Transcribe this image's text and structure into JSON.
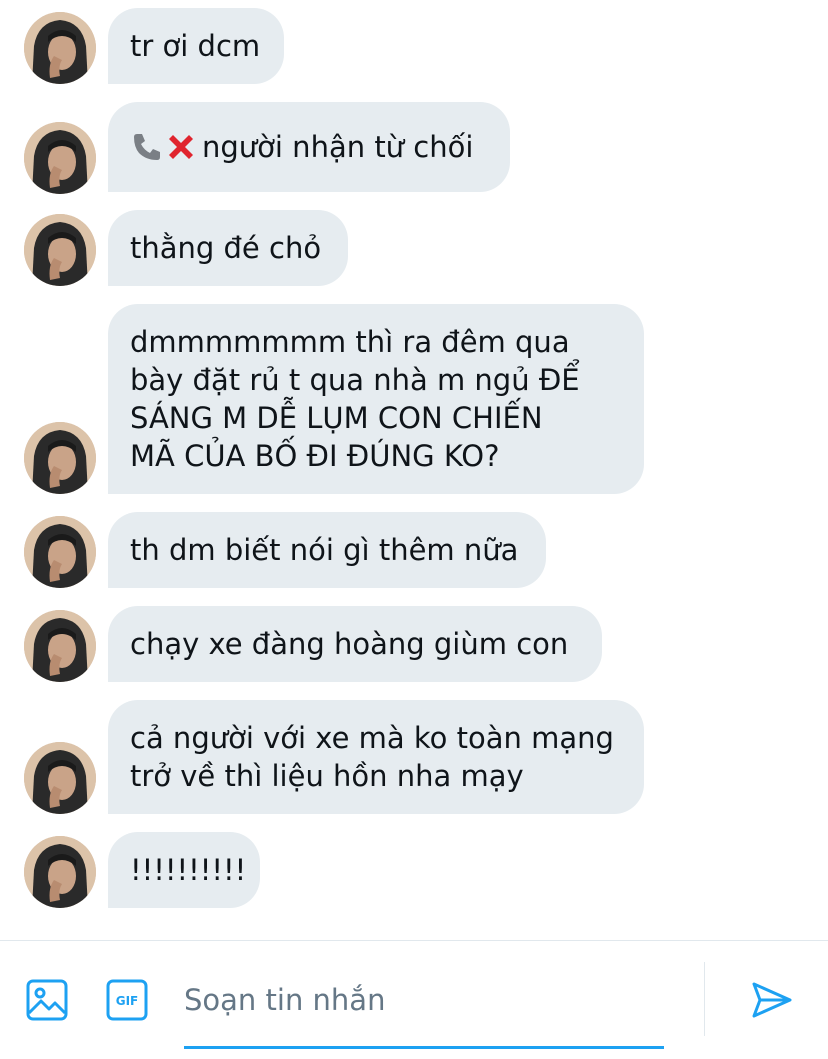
{
  "messages": [
    {
      "text": "tr ơi dcm"
    },
    {
      "text": "người nhận từ chối",
      "call_icons": [
        "phone-icon",
        "red-cross-icon"
      ]
    },
    {
      "text": "thằng đé chỏ"
    },
    {
      "text": "dmmmmmmm thì ra đêm qua\nbày đặt rủ t qua nhà m ngủ ĐỂ\nSÁNG M DỄ LỤM CON CHIẾN\nMÃ CỦA BỐ ĐI ĐÚNG KO?"
    },
    {
      "text": "th dm biết nói gì thêm nữa"
    },
    {
      "text": "chạy xe đàng hoàng giùm con"
    },
    {
      "text": "cả người với xe mà ko toàn mạng\ntrở về thì liệu hồn nha mạy"
    },
    {
      "text": "!!!!!!!!!!"
    }
  ],
  "composer": {
    "placeholder": "Soạn tin nhắn",
    "gif_label": "GIF",
    "icons": [
      "image-icon",
      "gif-icon",
      "send-icon"
    ]
  },
  "colors": {
    "bubble": "#e6ecf0",
    "accent": "#1da1f2",
    "placeholder": "#657786"
  }
}
